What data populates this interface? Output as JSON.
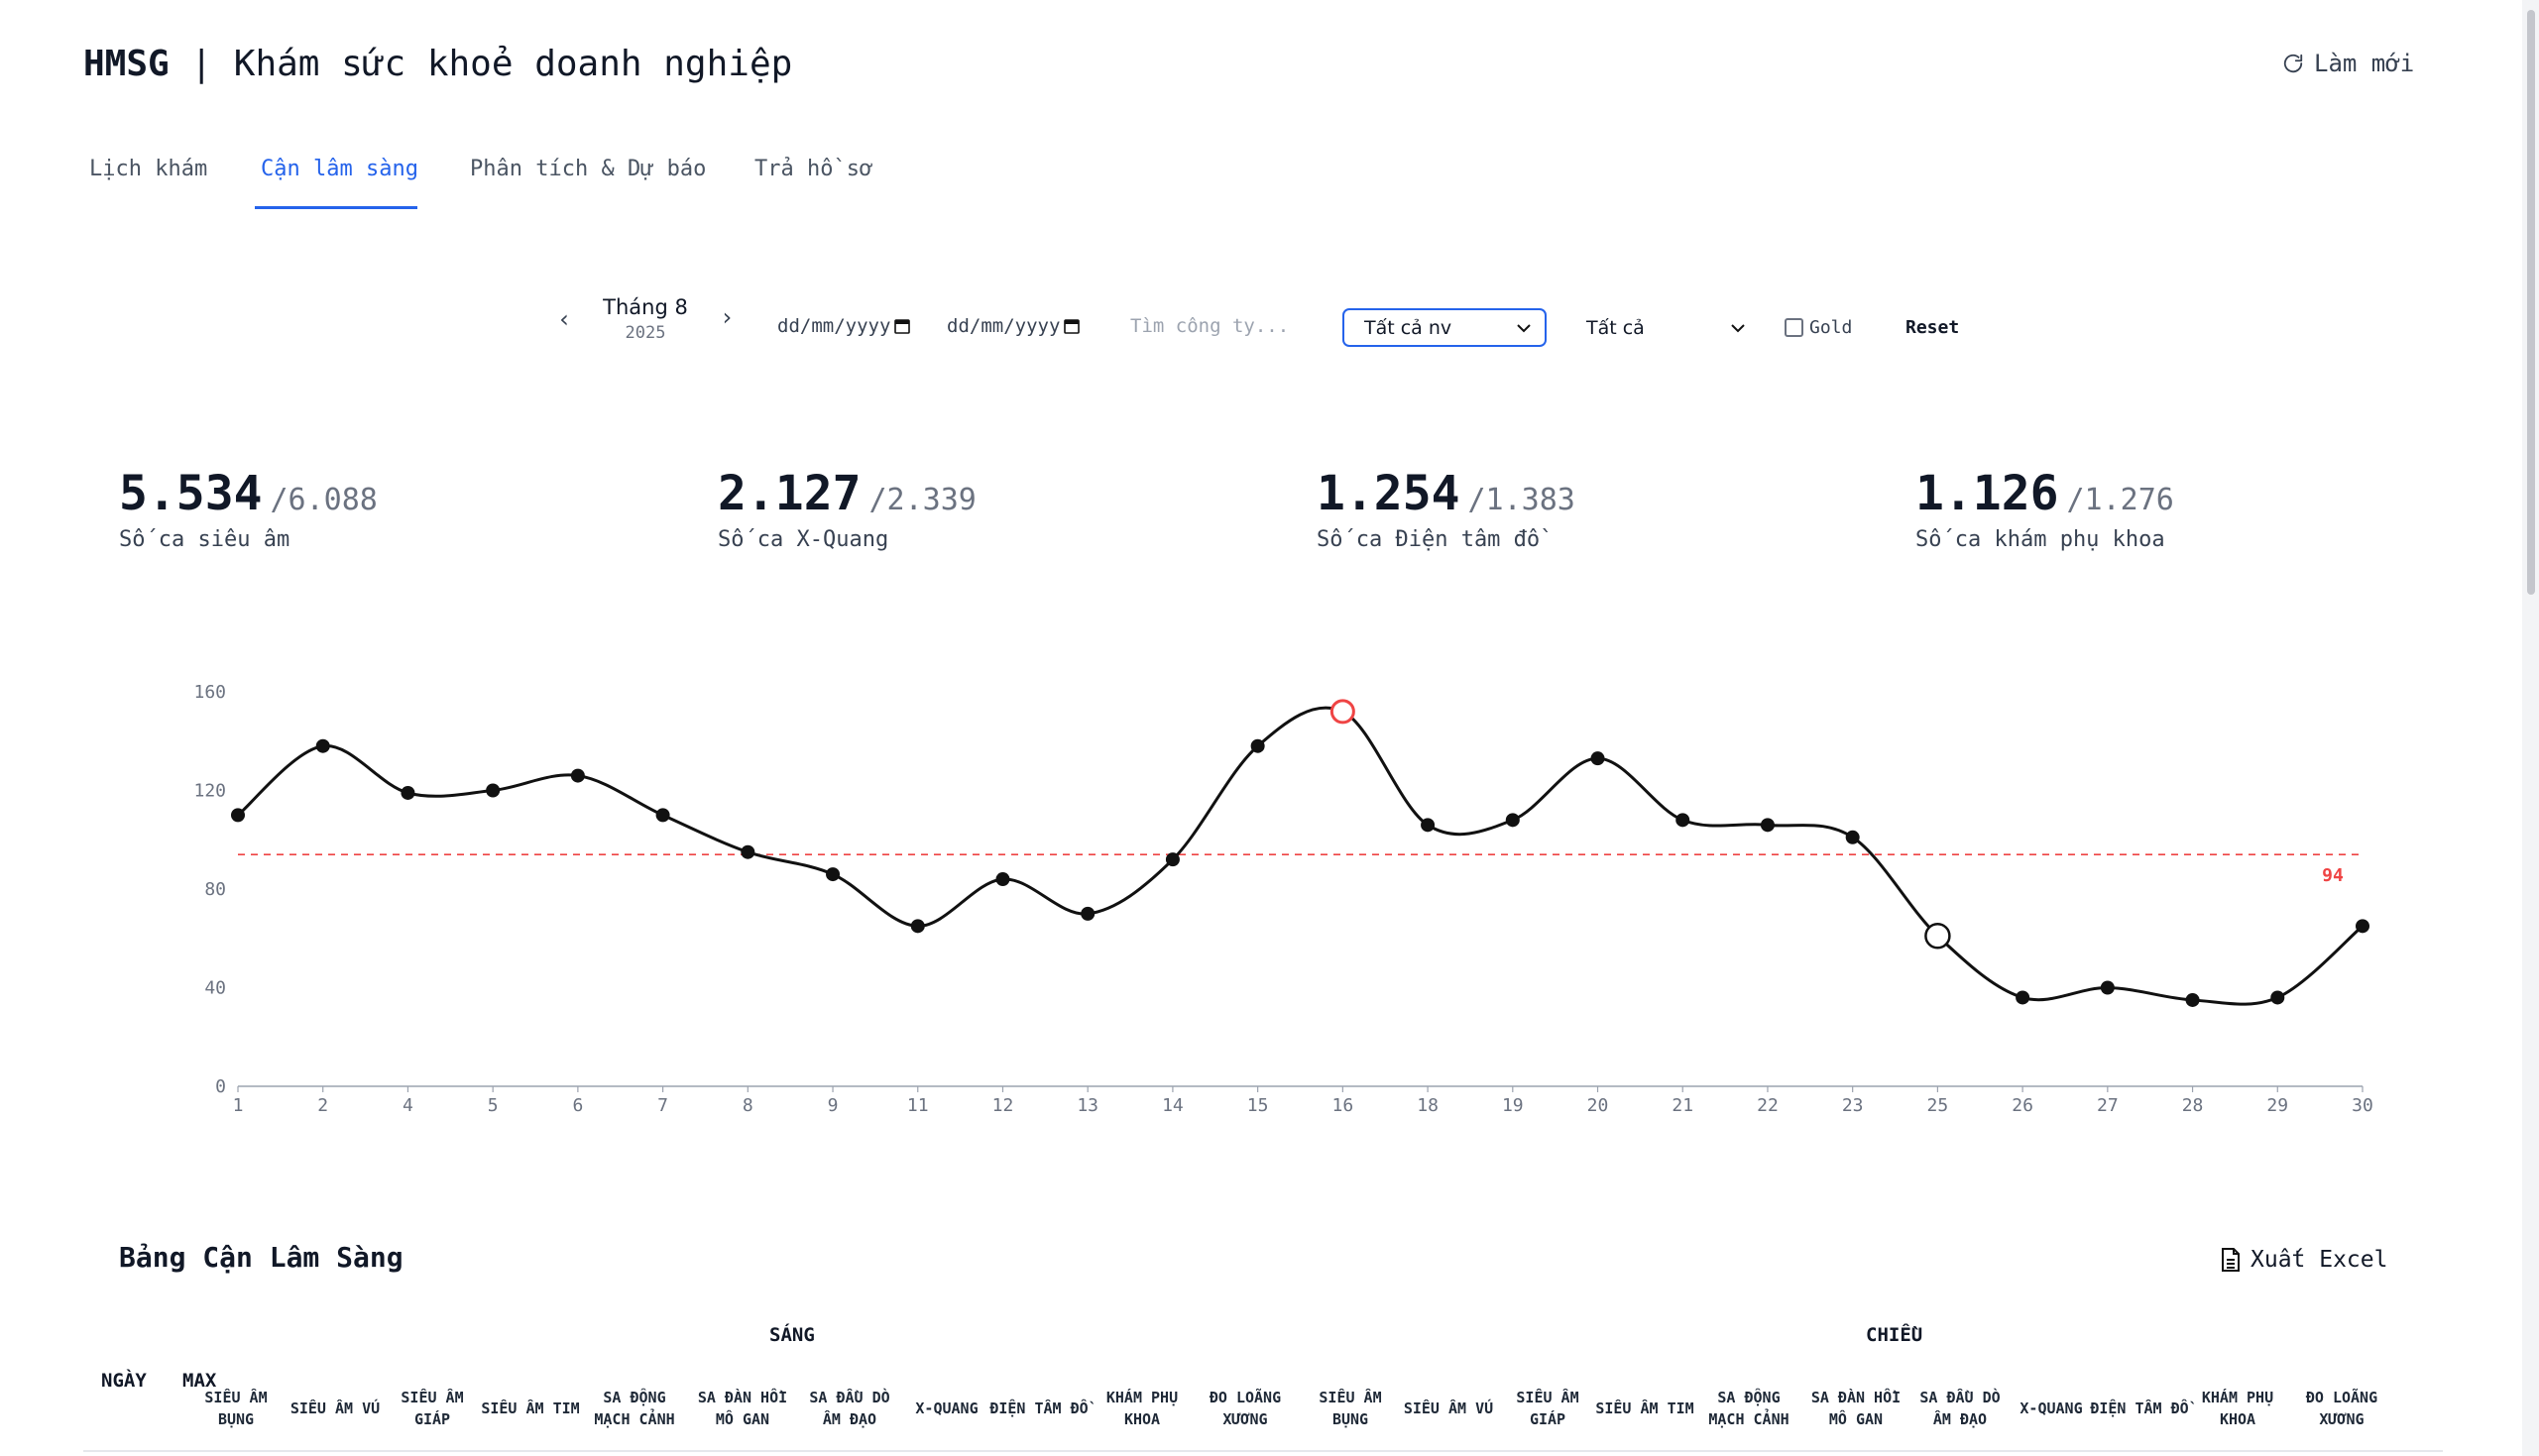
{
  "header": {
    "brand": "HMSG",
    "separator": "|",
    "title": "Khám sức khoẻ doanh nghiệp",
    "refresh_label": "Làm mới"
  },
  "tabs": [
    {
      "label": "Lịch khám",
      "active": false
    },
    {
      "label": "Cận lâm sàng",
      "active": true
    },
    {
      "label": "Phân tích & Dự báo",
      "active": false
    },
    {
      "label": "Trả hồ sơ",
      "active": false
    }
  ],
  "filters": {
    "month_label": "Tháng 8",
    "year_label": "2025",
    "date_from_placeholder": "dd/mm/yyyy",
    "date_to_placeholder": "dd/mm/yyyy",
    "search_placeholder": "Tìm công ty...",
    "staff_select": "Tất cả nv",
    "type_select": "Tất cả",
    "gold_label": "Gold",
    "gold_checked": false,
    "reset_label": "Reset"
  },
  "stats": [
    {
      "value": "5.534",
      "total": "/6.088",
      "label": "Số ca siêu âm"
    },
    {
      "value": "2.127",
      "total": "/2.339",
      "label": "Số ca X-Quang"
    },
    {
      "value": "1.254",
      "total": "/1.383",
      "label": "Số ca Điện tâm đồ"
    },
    {
      "value": "1.126",
      "total": "/1.276",
      "label": "Số ca khám phụ khoa"
    }
  ],
  "chart_data": {
    "type": "line",
    "categories": [
      "1",
      "2",
      "4",
      "5",
      "6",
      "7",
      "8",
      "9",
      "11",
      "12",
      "13",
      "14",
      "15",
      "16",
      "18",
      "19",
      "20",
      "21",
      "22",
      "23",
      "25",
      "26",
      "27",
      "28",
      "29",
      "30"
    ],
    "values": [
      110,
      138,
      119,
      120,
      126,
      110,
      95,
      86,
      65,
      84,
      70,
      92,
      138,
      152,
      106,
      108,
      133,
      108,
      106,
      101,
      61,
      36,
      40,
      35,
      36,
      65
    ],
    "ylim": [
      0,
      160
    ],
    "yticks": [
      0,
      40,
      80,
      120,
      160
    ],
    "reference_line": {
      "value": 94,
      "label": "94",
      "color": "#ef4444"
    },
    "highlight_max_index": 13,
    "highlight_min_open_index": 20,
    "line_color": "#111111",
    "grid": false
  },
  "table": {
    "title": "Bảng Cận Lâm Sàng",
    "export_label": "Xuất Excel",
    "group_morning": "SÁNG",
    "group_afternoon": "CHIỀU",
    "col_day": "NGÀY",
    "col_max": "MAX",
    "columns": [
      "SIÊU ÂM BỤNG",
      "SIÊU ÂM VÚ",
      "SIÊU ÂM GIÁP",
      "SIÊU ÂM TIM",
      "SA ĐỘNG MẠCH CẢNH",
      "SA ĐÀN HỒI MÔ GAN",
      "SA ĐẦU DÒ ÂM ĐẠO",
      "X-QUANG",
      "ĐIỆN TÂM ĐỒ",
      "KHÁM PHỤ KHOA",
      "ĐO LOÃNG XƯƠNG",
      "SIÊU ÂM BỤNG",
      "SIÊU ÂM VÚ",
      "SIÊU ÂM GIÁP",
      "SIÊU ÂM TIM",
      "SA ĐỘNG MẠCH CẢNH",
      "SA ĐÀN HỒI MÔ GAN",
      "SA ĐẦU DÒ ÂM ĐẠO",
      "X-QUANG",
      "ĐIỆN TÂM ĐỒ",
      "KHÁM PHỤ KHOA",
      "ĐO LOÃNG XƯƠNG"
    ]
  }
}
